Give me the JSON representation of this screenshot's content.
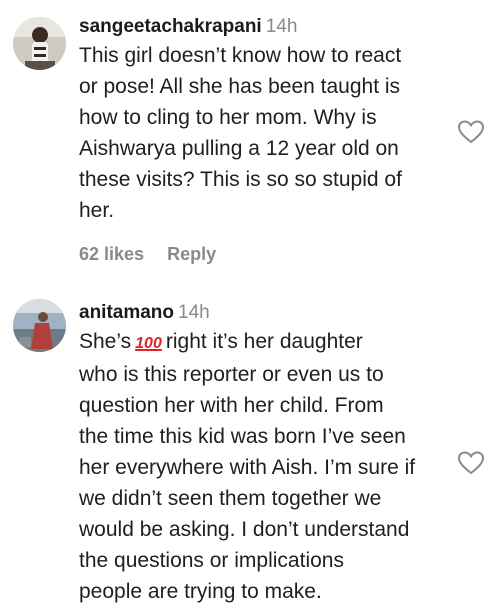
{
  "comments": [
    {
      "username": "sangeetachakrapani",
      "time": "14h",
      "lines": [
        "This girl doesn’t know how to react",
        "or pose! All she has been taught is",
        "how to cling to her mom. Why is",
        "Aishwarya pulling a 12 year old on",
        "these visits? This is so so stupid of",
        "her."
      ],
      "likes": "62 likes",
      "reply": "Reply",
      "like_icon": "heart-outline-icon"
    },
    {
      "username": "anitamano",
      "time": "14h",
      "first_line_pre": "She’s",
      "emoji": "100",
      "first_line_post": "right it’s her daughter",
      "lines": [
        "who is this reporter or even us to",
        "question her with her child. From",
        "the time this kid was born I’ve seen",
        "her everywhere with Aish. I’m sure if",
        "we didn’t seen them together we",
        "would be asking. I don’t understand",
        "the questions or implications",
        "people are trying to make."
      ],
      "like_icon": "heart-outline-icon"
    }
  ]
}
